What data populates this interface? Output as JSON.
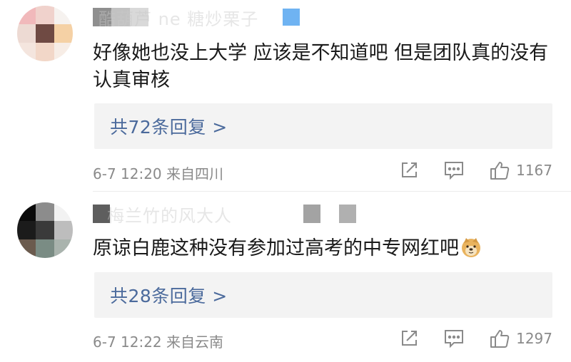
{
  "comments": [
    {
      "username_faded": "酷葫芦 ne 糖炒栗子",
      "content": "好像她也没上大学 应该是不知道吧 但是团队真的没有认真审核",
      "replies_label": "共72条回复 >",
      "date": "6-7 12:20",
      "location": "来自四川",
      "likes": "1167"
    },
    {
      "username_faded": "梅兰竹的风大人",
      "content": "原谅白鹿这种没有参加过高考的中专网红吧",
      "emoji": "doge-emoji",
      "replies_label": "共28条回复 >",
      "date": "6-7 12:22",
      "location": "来自云南",
      "likes": "1297"
    }
  ],
  "icons": {
    "share": "share-icon",
    "comment": "comment-icon",
    "like": "thumbs-up-icon",
    "badge": "member-badge-icon"
  },
  "colors": {
    "link": "#4b6a9c",
    "meta": "#8a8a8a",
    "reply_bg": "#f3f3f3",
    "badge": "#6fb3f2"
  }
}
